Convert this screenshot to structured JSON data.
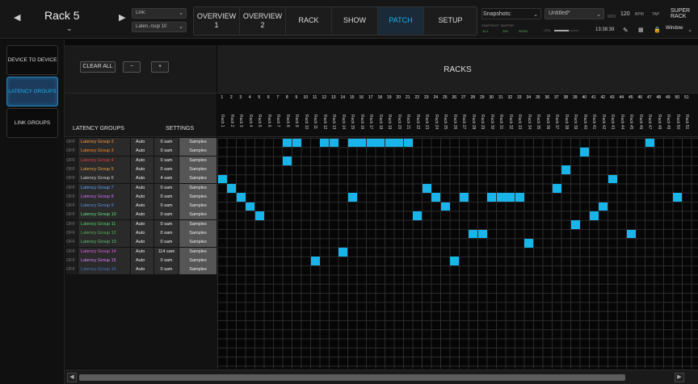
{
  "header": {
    "rack_title": "Rack 5",
    "link_label": "Link:",
    "link_value": "",
    "preset_value": "Laten..rsup 10",
    "nav": [
      {
        "label": "OVERVIEW",
        "sub": "1"
      },
      {
        "label": "OVERVIEW",
        "sub": "2"
      },
      {
        "label": "RACK",
        "sub": ""
      },
      {
        "label": "SHOW",
        "sub": ""
      },
      {
        "label": "PATCH",
        "sub": ""
      },
      {
        "label": "SETUP",
        "sub": ""
      }
    ],
    "snapshots_label": "Snapshots:",
    "snapshot_value": "Untitled*",
    "tempo": "120",
    "tempo_unit": "BPM",
    "tap_label": "TAP",
    "super_rack_label": "SUPER RACK",
    "time": "13:38:39",
    "window_label": "Window",
    "meter_labels": [
      "SNAPSHOT",
      "BUFFER"
    ],
    "meter_values": [
      "44.1",
      "256",
      "96000"
    ],
    "cpu_label": "CPU",
    "midi_label": "MIDI"
  },
  "sidebar": {
    "items": [
      {
        "label": "DEVICE TO DEVICE",
        "active": false
      },
      {
        "label": "LATENCY GROUPS",
        "active": true
      },
      {
        "label": "LINK GROUPS",
        "active": false
      }
    ]
  },
  "controls": {
    "clear_all": "CLEAR ALL",
    "minus": "−",
    "plus": "+"
  },
  "panel": {
    "racks_title": "RACKS",
    "latency_groups_header": "LATENCY GROUPS",
    "settings_header": "SETTINGS"
  },
  "columns": {
    "numbers": [
      "1",
      "2",
      "3",
      "4",
      "5",
      "6",
      "7",
      "8",
      "9",
      "10",
      "11",
      "12",
      "13",
      "14",
      "15",
      "16",
      "17",
      "18",
      "19",
      "20",
      "21",
      "22",
      "23",
      "24",
      "25",
      "26",
      "27",
      "28",
      "29",
      "30",
      "31",
      "32",
      "33",
      "34",
      "35",
      "36",
      "37",
      "38",
      "39",
      "40",
      "41",
      "42",
      "43",
      "44",
      "45",
      "46",
      "47",
      "48",
      "49",
      "50",
      "51"
    ],
    "names": [
      "Rack 1",
      "Rack 2",
      "Rack 3",
      "Rack 4",
      "Rack 5",
      "Rack 6",
      "Rack 7",
      "Rack 8",
      "Rack 9",
      "Rack 10",
      "Rack 11",
      "Rack 12",
      "Rack 13",
      "Rack 14",
      "Rack 15",
      "Rack 16",
      "Rack 17",
      "Rack 18",
      "Rack 19",
      "Rack 20",
      "Rack 21",
      "Rack 22",
      "Rack 23",
      "Rack 24",
      "Rack 25",
      "Rack 26",
      "Rack 27",
      "Rack 28",
      "Rack 29",
      "Rack 30",
      "Rack 31",
      "Rack 32",
      "Rack 33",
      "Rack 34",
      "Rack 35",
      "Rack 36",
      "Rack 37",
      "Rack 38",
      "Rack 39",
      "Rack 40",
      "Rack 41",
      "Rack 42",
      "Rack 43",
      "Rack 44",
      "Rack 45",
      "Rack 46",
      "Rack 47",
      "Rack 48",
      "Rack 49",
      "Rack 50",
      "Rack 51"
    ]
  },
  "groups": [
    {
      "off": "OFF",
      "name": "Latency Group 2",
      "color": "#ff9a3a",
      "mode": "Auto",
      "sam": "0 sam",
      "unit": "Samples"
    },
    {
      "off": "OFF",
      "name": "Latency Group 3",
      "color": "#ff8c2a",
      "mode": "Auto",
      "sam": "0 sam",
      "unit": "Samples"
    },
    {
      "off": "OFF",
      "name": "Latency Group 4",
      "color": "#e03a3a",
      "mode": "Auto",
      "sam": "0 sam",
      "unit": "Samples"
    },
    {
      "off": "OFF",
      "name": "Latency Group 5",
      "color": "#e8a040",
      "mode": "Auto",
      "sam": "0 sam",
      "unit": "Samples"
    },
    {
      "off": "OFF",
      "name": "Latency Group 6",
      "color": "#d0d0d0",
      "mode": "Auto",
      "sam": "4 sam",
      "unit": "Samples"
    },
    {
      "off": "OFF",
      "name": "Latency Group 7",
      "color": "#5aa0ff",
      "mode": "Auto",
      "sam": "0 sam",
      "unit": "Samples"
    },
    {
      "off": "OFF",
      "name": "Latency Group 8",
      "color": "#d070ff",
      "mode": "Auto",
      "sam": "0 sam",
      "unit": "Samples"
    },
    {
      "off": "OFF",
      "name": "Latency Group 9",
      "color": "#5a90e0",
      "mode": "Auto",
      "sam": "0 sam",
      "unit": "Samples"
    },
    {
      "off": "OFF",
      "name": "Latency Group 10",
      "color": "#60e080",
      "mode": "Auto",
      "sam": "0 sam",
      "unit": "Samples"
    },
    {
      "off": "OFF",
      "name": "Latency Group 11",
      "color": "#50d060",
      "mode": "Auto",
      "sam": "0 sam",
      "unit": "Samples"
    },
    {
      "off": "OFF",
      "name": "Latency Group 12",
      "color": "#50b050",
      "mode": "Auto",
      "sam": "0 sam",
      "unit": "Samples"
    },
    {
      "off": "OFF",
      "name": "Latency Group 13",
      "color": "#60c070",
      "mode": "Auto",
      "sam": "0 sam",
      "unit": "Samples"
    },
    {
      "off": "OFF",
      "name": "Latency Group 14",
      "color": "#e060e0",
      "mode": "Auto",
      "sam": "114 sam",
      "unit": "Samples"
    },
    {
      "off": "OFF",
      "name": "Latency Group 15",
      "color": "#e080ff",
      "mode": "Auto",
      "sam": "0 sam",
      "unit": "Samples"
    },
    {
      "off": "OFF",
      "name": "Latency Group 16",
      "color": "#4a70c0",
      "mode": "Auto",
      "sam": "0 sam",
      "unit": "Samples"
    }
  ],
  "assignments": [
    [
      [
        7,
        8
      ],
      [
        11,
        12
      ],
      [
        14,
        15,
        16,
        17,
        18,
        19,
        20
      ],
      [
        46
      ]
    ],
    [
      [
        39
      ]
    ],
    [
      [
        7
      ]
    ],
    [
      [
        37
      ]
    ],
    [
      [
        0
      ],
      [
        42
      ]
    ],
    [
      [
        1
      ],
      [
        22
      ],
      [
        36
      ]
    ],
    [
      [
        2
      ],
      [
        14
      ],
      [
        23
      ],
      [
        26
      ],
      [
        29,
        30,
        31,
        32
      ],
      [
        49
      ]
    ],
    [
      [
        3
      ],
      [
        24
      ],
      [
        41
      ]
    ],
    [
      [
        4
      ],
      [
        21
      ],
      [
        40
      ]
    ],
    [
      [
        38
      ]
    ],
    [
      [
        27,
        28
      ],
      [
        44
      ]
    ],
    [
      [
        33
      ]
    ],
    [
      [
        13
      ]
    ],
    [
      [
        10
      ],
      [
        25
      ]
    ],
    []
  ],
  "colors": {
    "accent": "#19b4ea",
    "assigned": "#19b4ea"
  }
}
